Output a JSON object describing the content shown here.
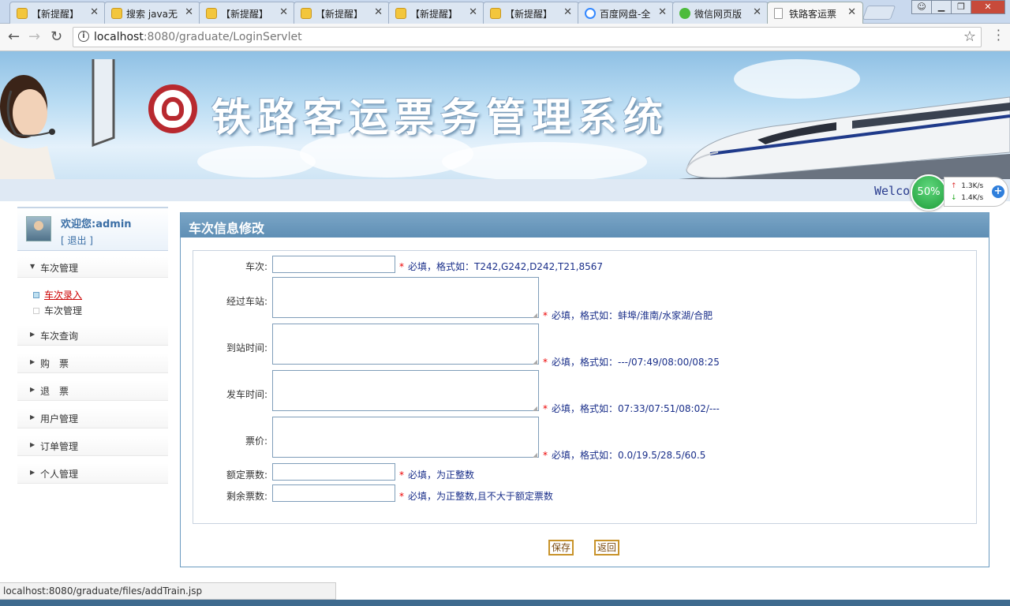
{
  "browser": {
    "tabs": [
      {
        "title": "【新提醒】",
        "icon": "hint-icon"
      },
      {
        "title": "搜索 java无",
        "icon": "hint-icon"
      },
      {
        "title": "【新提醒】",
        "icon": "hint-icon"
      },
      {
        "title": "【新提醒】",
        "icon": "hint-icon"
      },
      {
        "title": "【新提醒】",
        "icon": "hint-icon"
      },
      {
        "title": "【新提醒】",
        "icon": "hint-icon"
      },
      {
        "title": "百度网盘-全",
        "icon": "baidu-icon"
      },
      {
        "title": "微信网页版",
        "icon": "wechat-icon"
      },
      {
        "title": "铁路客运票",
        "icon": "document-icon",
        "active": true
      }
    ],
    "address": {
      "host": "localhost",
      "path": ":8080/graduate/LoginServlet"
    },
    "status_url": "localhost:8080/graduate/files/addTrain.jsp"
  },
  "banner": {
    "title": "铁路客运票务管理系统"
  },
  "strip": {
    "welcome_partial": "Welco"
  },
  "speed_widget": {
    "percent": "50%",
    "upload": "1.3K/s",
    "download": "1.4K/s"
  },
  "sidebar": {
    "welcome": "欢迎您:admin",
    "logout": "[ 退出 ]",
    "menus": [
      {
        "label": "车次管理",
        "expanded": true,
        "children": [
          {
            "label": "车次录入",
            "current": true
          },
          {
            "label": "车次管理",
            "current": false
          }
        ]
      },
      {
        "label": "车次查询",
        "expanded": false
      },
      {
        "label": "购　票",
        "expanded": false
      },
      {
        "label": "退　票",
        "expanded": false
      },
      {
        "label": "用户管理",
        "expanded": false
      },
      {
        "label": "订单管理",
        "expanded": false
      },
      {
        "label": "个人管理",
        "expanded": false
      }
    ]
  },
  "panel": {
    "title": "车次信息修改",
    "fields": [
      {
        "label": "车次:",
        "value": "",
        "hint": "必填，格式如：T242,G242,D242,T21,8567"
      },
      {
        "label": "经过车站:",
        "value": "",
        "hint": "必填，格式如：蚌埠/淮南/水家湖/合肥"
      },
      {
        "label": "到站时间:",
        "value": "",
        "hint": "必填，格式如：---/07:49/08:00/08:25"
      },
      {
        "label": "发车时间:",
        "value": "",
        "hint": "必填，格式如：07:33/07:51/08:02/---"
      },
      {
        "label": "票价:",
        "value": "",
        "hint": "必填，格式如：0.0/19.5/28.5/60.5"
      },
      {
        "label": "额定票数:",
        "value": "",
        "hint": "必填，为正整数"
      },
      {
        "label": "剩余票数:",
        "value": "",
        "hint": "必填，为正整数,且不大于额定票数"
      }
    ],
    "required_mark": "*",
    "save_label": "保存",
    "back_label": "返回"
  },
  "colors": {
    "panel_header": "#6b9bc0",
    "hint_text": "#1a2f8a",
    "required": "#e00000",
    "button_border": "#c8932a"
  }
}
